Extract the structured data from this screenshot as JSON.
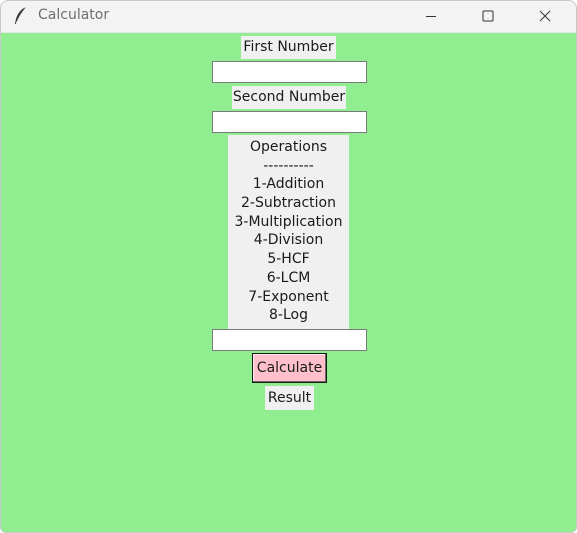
{
  "window": {
    "title": "Calculator",
    "icon": "feather-icon",
    "background_color": "#90ee90"
  },
  "controls": {
    "minimize_icon": "minimize-icon",
    "maximize_icon": "maximize-icon",
    "close_icon": "close-icon"
  },
  "form": {
    "first_number_label": "First Number",
    "first_number_value": "",
    "second_number_label": "Second Number",
    "second_number_value": "",
    "operations_title": "Operations",
    "operations_divider": "----------",
    "operations": [
      "1-Addition",
      "2-Subtraction",
      "3-Multiplication",
      "4-Division",
      "5-HCF",
      "6-LCM",
      "7-Exponent",
      "8-Log"
    ],
    "operation_choice_value": "",
    "calculate_label": "Calculate",
    "calculate_color": "#ffc0cb",
    "result_label": "Result"
  }
}
